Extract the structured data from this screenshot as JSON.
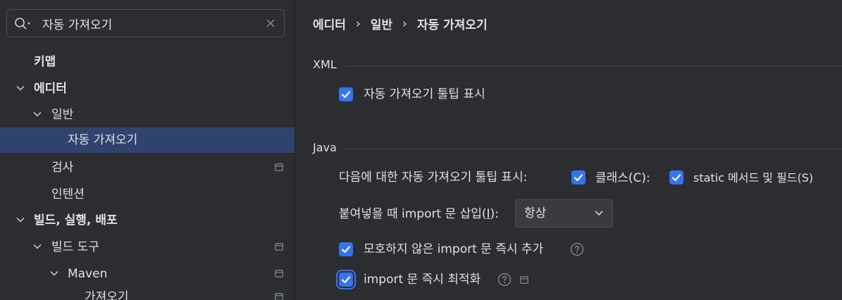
{
  "search": {
    "value": "자동 가져오기",
    "placeholder": ""
  },
  "tree": [
    {
      "label": "키맵",
      "bold": true
    },
    {
      "label": "에디터",
      "bold": true
    },
    {
      "label": "일반",
      "bold": false
    },
    {
      "label": "자동 가져오기",
      "bold": false,
      "selected": true
    },
    {
      "label": "검사",
      "bold": false
    },
    {
      "label": "인텐션",
      "bold": false
    },
    {
      "label": "빌드, 실행, 배포",
      "bold": true
    },
    {
      "label": "빌드 도구",
      "bold": false
    },
    {
      "label": "Maven",
      "bold": false
    },
    {
      "label": "가져오기",
      "bold": false
    }
  ],
  "breadcrumb": [
    "에디터",
    "일반",
    "자동 가져오기"
  ],
  "breadcrumb_separator": "›",
  "xml": {
    "title": "XML",
    "show_tooltip": {
      "label": "자동 가져오기 툴팁 표시",
      "checked": true
    }
  },
  "java": {
    "title": "Java",
    "tooltip_row_label": "다음에 대한 자동 가져오기 툴팁 표시:",
    "classes": {
      "label": "클래스(C):",
      "checked": true
    },
    "static_members": {
      "label": "static 메서드 및 필드(S)",
      "checked": true
    },
    "insert_on_paste": {
      "label_before": "붙여넣을 때 import 문 삽입(",
      "mnemonic": "I",
      "label_after": "):",
      "value": "항상"
    },
    "add_unambiguous": {
      "label": "모호하지 않은 import 문 즉시 추가",
      "checked": true
    },
    "optimize_imports": {
      "label": "import 문 즉시 최적화",
      "checked": true
    }
  },
  "colors": {
    "background": "#2b2d30",
    "selection": "#2e436e",
    "accent": "#3574f0",
    "text": "#dfe1e5"
  }
}
